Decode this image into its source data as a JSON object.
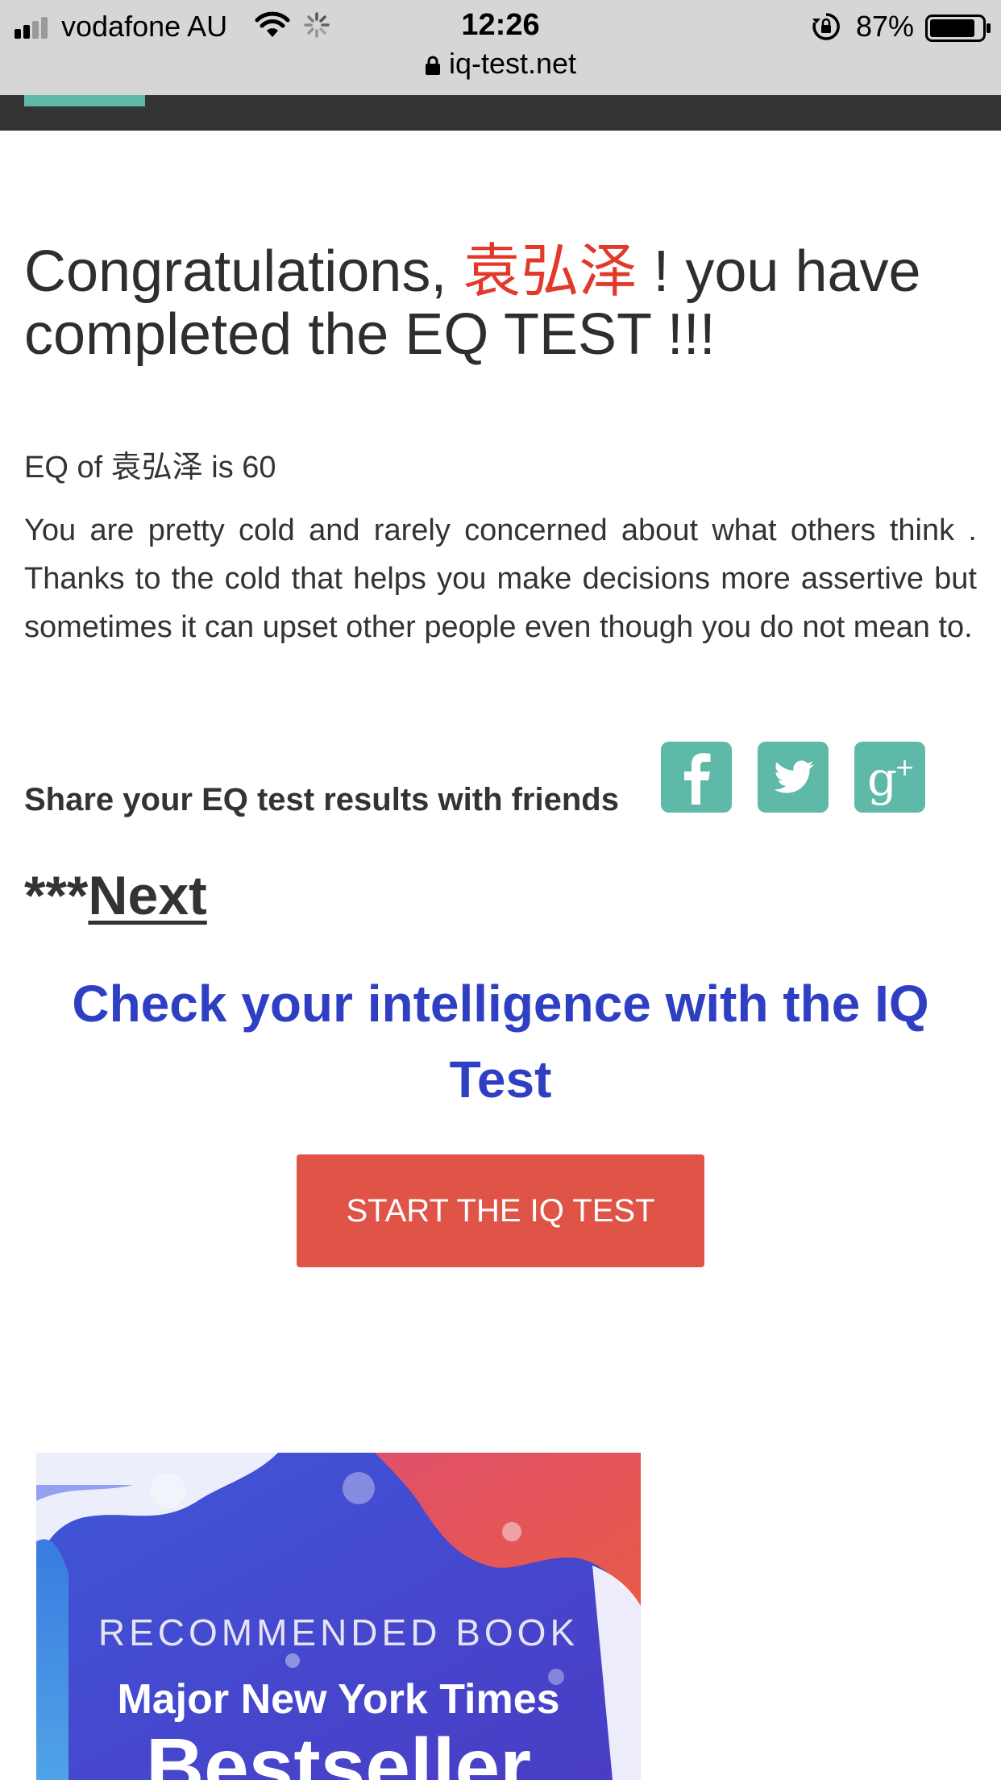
{
  "status_bar": {
    "carrier": "vodafone AU",
    "time": "12:26",
    "battery": "87%",
    "battery_level": 0.87,
    "url": "iq-test.net"
  },
  "headline": {
    "prefix": "Congratulations, ",
    "name": "袁弘泽",
    "suffix": " ! you have completed the EQ TEST !!!",
    "name_color": "#e2392a"
  },
  "result": {
    "score_line": "EQ of 袁弘泽 is 60",
    "description": "You are pretty cold and rarely concerned about what others think . Thanks to the cold that helps you make decisions more assertive but sometimes it can upset other people even though you do not mean to."
  },
  "share": {
    "label": "Share your EQ test results with friends",
    "buttons": [
      {
        "icon": "facebook-icon"
      },
      {
        "icon": "twitter-icon"
      },
      {
        "icon": "google-plus-icon"
      }
    ],
    "color": "#5fb9a8"
  },
  "next": {
    "prefix": "***",
    "link_label": "Next"
  },
  "iq_promo": {
    "text": "Check your intelligence with the IQ Test",
    "color": "#2e3fc4"
  },
  "cta": {
    "label": "START THE IQ TEST",
    "color": "#e05447"
  },
  "book_ad": {
    "kicker": "RECOMMENDED BOOK",
    "title_line1": "Major New York Times",
    "title_line2": "Bestseller"
  }
}
